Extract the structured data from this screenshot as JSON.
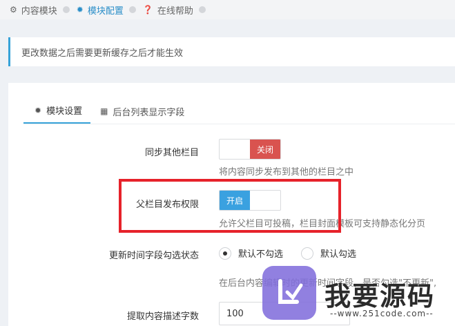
{
  "topbar": {
    "items": [
      {
        "label": "内容模块",
        "active": false
      },
      {
        "label": "模块配置",
        "active": true
      },
      {
        "label": "在线帮助",
        "active": false
      }
    ]
  },
  "note": {
    "text": "更改数据之后需要更新缓存之后才能生效"
  },
  "tabs": [
    {
      "label": "模块设置",
      "active": true
    },
    {
      "label": "后台列表显示字段",
      "active": false
    }
  ],
  "form": {
    "sync": {
      "label": "同步其他栏目",
      "toggle_text": "关闭",
      "help": "将内容同步发布到其他的栏目之中"
    },
    "parent_publish": {
      "label": "父栏目发布权限",
      "toggle_text": "开启",
      "help": "允许父栏目可投稿，栏目封面模板可支持静态化分页"
    },
    "update_time": {
      "label": "更新时间字段勾选状态",
      "options": [
        "默认不勾选",
        "默认勾选"
      ],
      "selected": "默认不勾选",
      "help": "在后台内容编辑时的更新时间字段，是否勾选\"不更新\","
    },
    "desc_len": {
      "label": "提取内容描述字数",
      "value": "100"
    }
  },
  "watermark": {
    "text": "我要源码",
    "url": "--www.251code.com--"
  },
  "colors": {
    "accent": "#3aa1e0",
    "danger": "#d9534f",
    "highlight": "#e6222a"
  }
}
